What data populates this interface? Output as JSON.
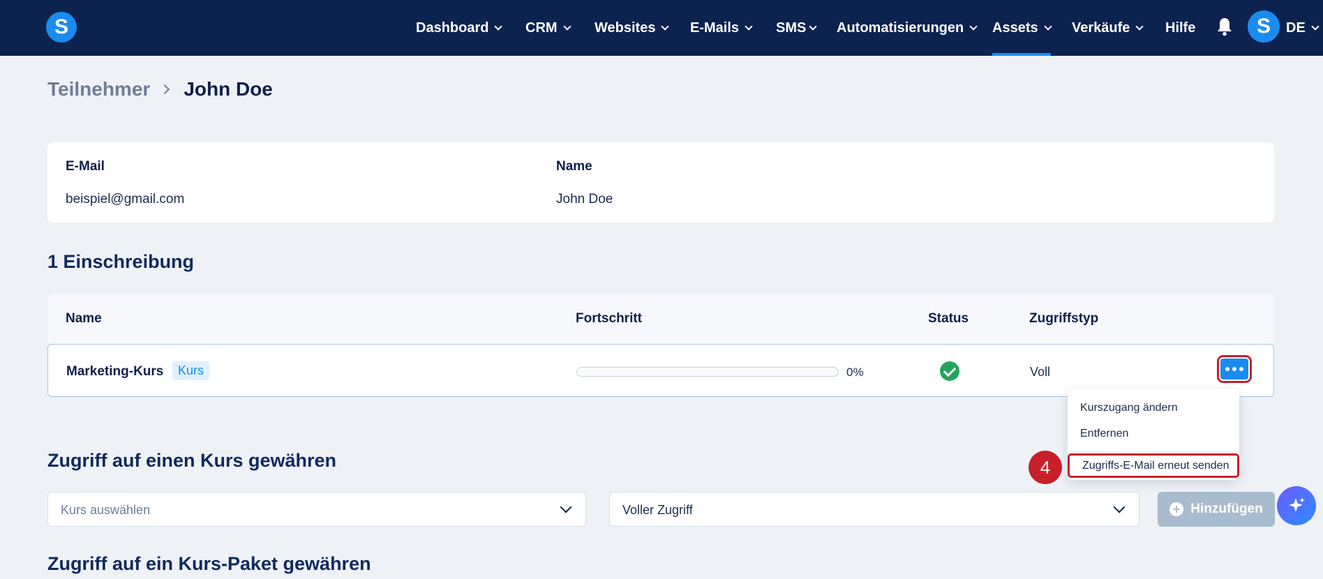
{
  "nav": {
    "items": [
      {
        "label": "Dashboard"
      },
      {
        "label": "CRM"
      },
      {
        "label": "Websites"
      },
      {
        "label": "E-Mails"
      },
      {
        "label": "SMS"
      },
      {
        "label": "Automatisierungen"
      },
      {
        "label": "Assets",
        "active": true
      },
      {
        "label": "Verkäufe"
      },
      {
        "label": "Hilfe"
      }
    ],
    "language": "DE",
    "logo_letter": "S",
    "avatar_letter": "S",
    "icons": [
      "bell-icon",
      "chevron-down-icon"
    ]
  },
  "breadcrumb": {
    "parent": "Teilnehmer",
    "current": "John Doe"
  },
  "contact": {
    "email_label": "E-Mail",
    "email": "beispiel@gmail.com",
    "name_label": "Name",
    "name": "John Doe"
  },
  "enrollments": {
    "title": "1 Einschreibung",
    "columns": [
      "Name",
      "Fortschritt",
      "Status",
      "Zugriffstyp"
    ],
    "rows": [
      {
        "name": "Marketing-Kurs",
        "tag": "Kurs",
        "progress": 0,
        "progress_label": "0%",
        "status": "check-circle-icon",
        "access": "Voll"
      }
    ]
  },
  "row_menu": {
    "items": [
      "Kurszugang ändern",
      "Entfernen",
      "Zugriffs-E-Mail erneut senden"
    ],
    "highlighted_index": 2,
    "step_badge": "4"
  },
  "grant_course": {
    "title": "Zugriff auf einen Kurs gewähren",
    "course_select_placeholder": "Kurs auswählen",
    "access_select_value": "Voller Zugriff",
    "add_button": "Hinzufügen"
  },
  "grant_bundle": {
    "title": "Zugriff auf ein Kurs-Paket gewähren"
  },
  "colors": {
    "navbar": "#0c2350",
    "accent": "#1a8cf0",
    "highlight": "#c8202a",
    "success": "#22a55a"
  }
}
